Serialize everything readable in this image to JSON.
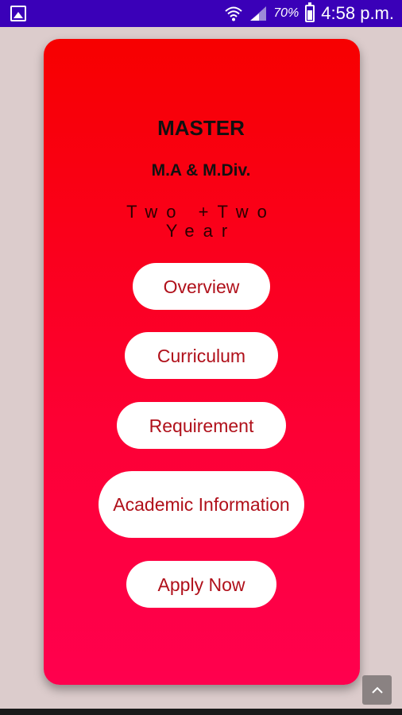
{
  "status_bar": {
    "battery_percent": "70%",
    "time": "4:58 p.m.",
    "icons": [
      "image-icon",
      "wifi-icon",
      "signal-icon",
      "battery-icon"
    ]
  },
  "card": {
    "title": "MASTER",
    "subtitle": "M.A & M.Div.",
    "duration": "Two +Two Year"
  },
  "buttons": {
    "overview": "Overview",
    "curriculum": "Curriculum",
    "requirement": "Requirement",
    "academic_information": "Academic Information",
    "apply_now": "Apply Now"
  },
  "colors": {
    "status_bar": "#3a00b8",
    "card_top": "#f70000",
    "card_bottom": "#ff004e",
    "button_text": "#b0101a",
    "background": "#dccccc"
  },
  "scroll_top_icon": "chevron-up-icon"
}
